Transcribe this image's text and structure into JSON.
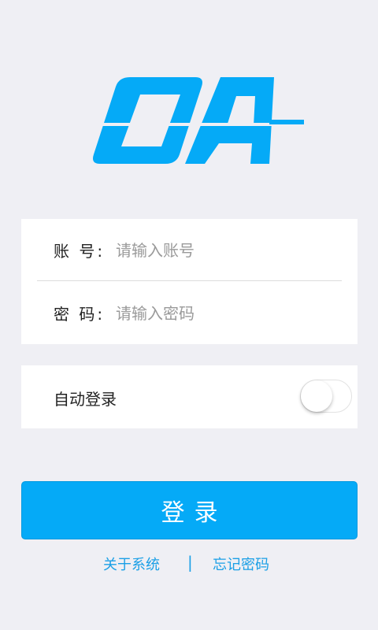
{
  "brand": {
    "logo_text": "OA",
    "color": "#05aaf7"
  },
  "form": {
    "account_label": "账 号:",
    "account_placeholder": "请输入账号",
    "password_label": "密 码:",
    "password_placeholder": "请输入密码"
  },
  "auto_login": {
    "label": "自动登录",
    "enabled": false
  },
  "login_button": {
    "label": "登录"
  },
  "footer": {
    "about_label": "关于系统",
    "separator": "|",
    "forgot_label": "忘记密码"
  },
  "colors": {
    "background": "#efeff4",
    "primary": "#05aaf7",
    "link": "#1a9fe6"
  }
}
